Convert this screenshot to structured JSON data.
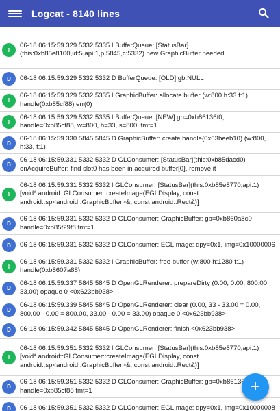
{
  "app": {
    "title": "Logcat - 8140 lines",
    "icons": {
      "menu": "menu-icon",
      "search": "search-icon",
      "fab": "plus-icon"
    },
    "colors": {
      "appbar": "#3f51b5",
      "info": "#1eb65a",
      "debug": "#3f6fd1",
      "fab": "#2196f3"
    }
  },
  "fab": {
    "label": "+"
  },
  "log_rows": [
    {
      "level": "I",
      "text": "06-18 06:15:59.329  5332  5335 I BufferQueue: [StatusBar](this:0xb85e8100,id:5,api:1,p:5845,c:5332) new GraphicBuffer needed"
    },
    {
      "level": "D",
      "text": "06-18 06:15:59.329  5332  5332 D BufferQueue:     [OLD] gb:NULL"
    },
    {
      "level": "I",
      "text": "06-18 06:15:59.329  5332  5335 I GraphicBuffer: allocate buffer (w:800 h:33 f:1) handle(0xb85cf88) err(0)"
    },
    {
      "level": "I",
      "text": "06-18 06:15:59.329  5332  5335 I BufferQueue:     [NEW] gb=0xb86136f0, handle=0xb85cf88, w=800, h=33, s=800, fmt=1"
    },
    {
      "level": "D",
      "text": "06-18 06:15:59.330  5845  5845 D GraphicBuffer: create handle(0x63beeb10) (w:800, h:33, f:1)"
    },
    {
      "level": "D",
      "text": "06-18 06:15:59.331  5332  5332 D GLConsumer: [StatusBar](this:0xb85dacd0) onAcquireBuffer: find slot0 has been in acquired buffer[0], remove it"
    },
    {
      "level": "I",
      "text": "06-18 06:15:59.331  5332  5332 I GLConsumer: [StatusBar](this:0xb85e8770,api:1) [void* android::GLConsumer::createImage(EGLDisplay, const android::sp<android::GraphicBuffer>&, const android::Rect&)]"
    },
    {
      "level": "D",
      "text": "06-18 06:15:59.331  5332  5332 D GLConsumer:     GraphicBuffer: gb=0xb860a8c0 handle=0xb85f29f8 fmt=1"
    },
    {
      "level": "D",
      "text": "06-18 06:15:59.331  5332  5332 D GLConsumer:     EGLImage: dpy=0x1, img=0x10000006"
    },
    {
      "level": "I",
      "text": "06-18 06:15:59.331  5332  5332 I GraphicBuffer: free buffer (w:800 h:1280 f:1) handle(0xb8607a88)"
    },
    {
      "level": "D",
      "text": "06-18 06:15:59.337  5845  5845 D OpenGLRenderer: prepareDirty (0.00, 0.00, 800.00, 33.00) opaque 0 <0x623bb938>"
    },
    {
      "level": "D",
      "text": "06-18 06:15:59.339  5845  5845 D OpenGLRenderer: clear (0.00, 33 - 33.00 = 0.00, 800.00 - 0.00 = 800.00, 33.00 - 0.00 = 33.00) opaque 0 <0x623bb938>"
    },
    {
      "level": "D",
      "text": "06-18 06:15:59.342  5845  5845 D OpenGLRenderer: finish <0x623bb938>"
    },
    {
      "level": "I",
      "text": "06-18 06:15:59.351  5332  5332 I GLConsumer: [StatusBar](this:0xb85e8770,api:1) [void* android::GLConsumer::createImage(EGLDisplay, const android::sp<android::GraphicBuffer>&, const android::Rect&)]"
    },
    {
      "level": "D",
      "text": "06-18 06:15:59.351  5332  5332 D GLConsumer:     GraphicBuffer: gb=0xb86136f0 handle=0xb85cf88 fmt=1"
    },
    {
      "level": "D",
      "text": "06-18 06:15:59.351  5332  5332 D GLConsumer:     EGLImage: dpy=0x1, img=0x10000008"
    }
  ]
}
